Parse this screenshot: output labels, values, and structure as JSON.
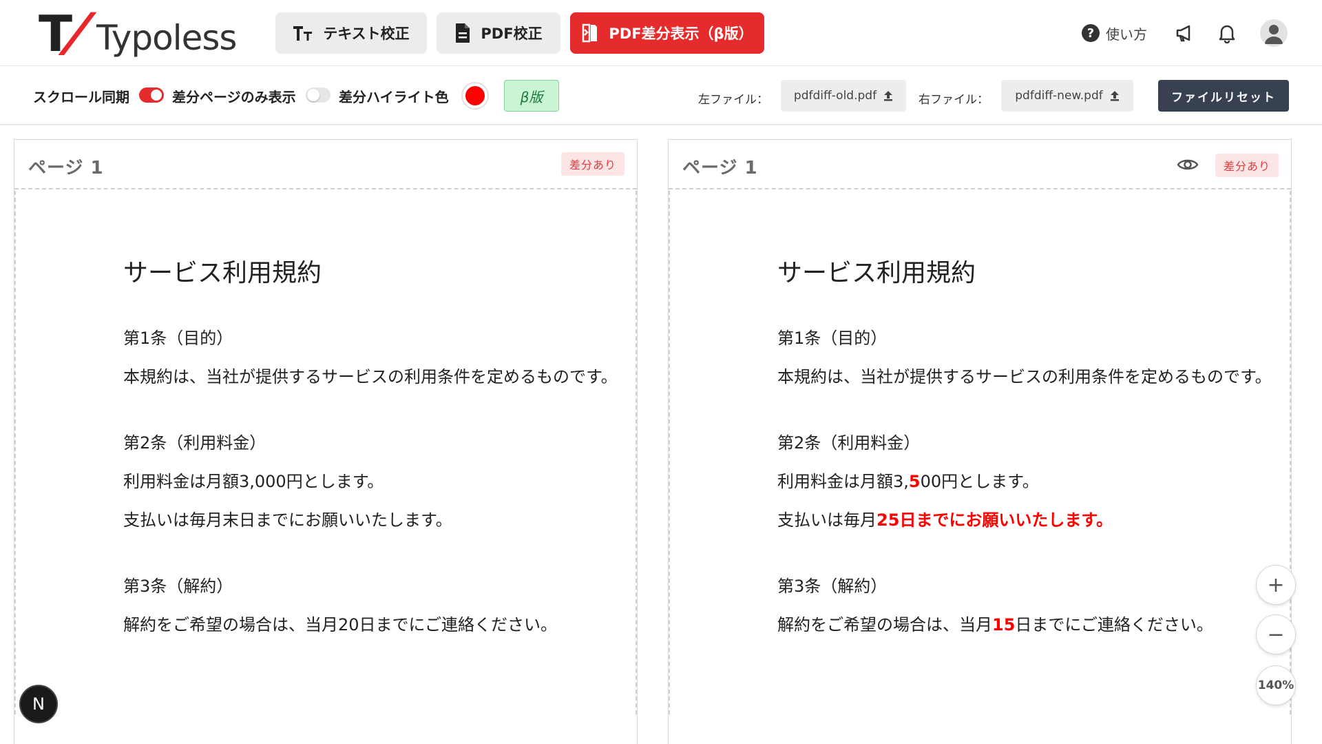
{
  "app": {
    "logo_text": "Typoless",
    "logo_mark_letter": "T",
    "logo_mark_bang": "/"
  },
  "nav": {
    "text_check": "テキスト校正",
    "pdf_check": "PDF校正",
    "pdf_diff": "PDF差分表示（β版）"
  },
  "header": {
    "help_label": "使い方",
    "icons": [
      "help-icon",
      "megaphone-icon",
      "bell-icon",
      "user-avatar-icon"
    ]
  },
  "toolbar": {
    "scroll_sync_label": "スクロール同期",
    "scroll_sync_on": true,
    "diff_only_label": "差分ページのみ表示",
    "diff_only_on": false,
    "highlight_color_label": "差分ハイライト色",
    "highlight_color": "#ff0000",
    "beta_label": "β版",
    "left_file_label": "左ファイル：",
    "left_file_name": "pdfdiff-old.pdf",
    "right_file_label": "右ファイル：",
    "right_file_name": "pdfdiff-new.pdf",
    "reset_label": "ファイルリセット"
  },
  "left_panel": {
    "page_title": "ページ 1",
    "diff_badge": "差分あり",
    "doc": {
      "title": "サービス利用規約",
      "art1_heading": "第1条（目的）",
      "art1_body": "本規約は、当社が提供するサービスの利用条件を定めるものです。",
      "art2_heading": "第2条（利用料金）",
      "art2_line1": "利用料金は月額3,000円とします。",
      "art2_line2": "支払いは毎月末日までにお願いいたします。",
      "art3_heading": "第3条（解約）",
      "art3_body": "解約をご希望の場合は、当月20日までにご連絡ください。"
    }
  },
  "right_panel": {
    "page_title": "ページ 1",
    "diff_badge": "差分あり",
    "doc": {
      "title": "サービス利用規約",
      "art1_heading": "第1条（目的）",
      "art1_body": "本規約は、当社が提供するサービスの利用条件を定めるものです。",
      "art2_heading": "第2条（利用料金）",
      "art2_line1_pre": "利用料金は月額3,",
      "art2_line1_diff": "5",
      "art2_line1_post": "00円とします。",
      "art2_line2_pre": "支払いは毎月",
      "art2_line2_diff": "25日までにお願いいたします。",
      "art3_heading": "第3条（解約）",
      "art3_body_pre": "解約をご希望の場合は、当月",
      "art3_body_diff": "15",
      "art3_body_post": "日までにご連絡ください。"
    }
  },
  "zoom": {
    "in_label": "+",
    "out_label": "−",
    "level": "140%"
  },
  "dev_badge": "N"
}
